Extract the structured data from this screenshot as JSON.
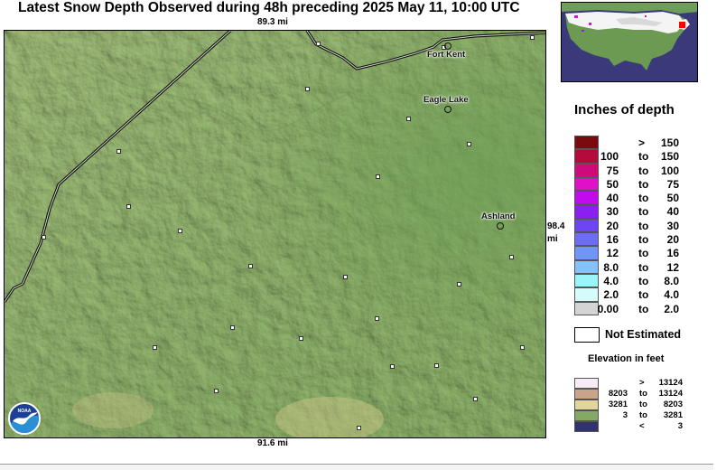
{
  "title": "Latest Snow Depth Observed during 48h preceding 2025 May 11, 10:00 UTC",
  "scale": {
    "top": "89.3 mi",
    "bottom": "91.6 mi",
    "right_value": "98.4",
    "right_unit": "mi"
  },
  "map": {
    "cities": [
      {
        "name": "Fort Kent"
      },
      {
        "name": "Eagle Lake"
      },
      {
        "name": "Ashland"
      }
    ],
    "station_count": 25,
    "logo_text": "NOAA",
    "colors": {
      "terrain_low": "#8db36a",
      "terrain_mid": "#a3c07c",
      "border": "#222222"
    }
  },
  "legend": {
    "title": "Inches of depth",
    "rows": [
      {
        "lo": "",
        "to": ">",
        "hi": "150",
        "color": "#7a0a0f"
      },
      {
        "lo": "100",
        "to": "to",
        "hi": "150",
        "color": "#b40a3c"
      },
      {
        "lo": "75",
        "to": "to",
        "hi": "100",
        "color": "#cf0a79"
      },
      {
        "lo": "50",
        "to": "to",
        "hi": "75",
        "color": "#df10c5"
      },
      {
        "lo": "40",
        "to": "to",
        "hi": "50",
        "color": "#c30aef"
      },
      {
        "lo": "30",
        "to": "to",
        "hi": "40",
        "color": "#8a1ff1"
      },
      {
        "lo": "20",
        "to": "to",
        "hi": "30",
        "color": "#6d45f3"
      },
      {
        "lo": "16",
        "to": "to",
        "hi": "20",
        "color": "#6c6df4"
      },
      {
        "lo": "12",
        "to": "to",
        "hi": "16",
        "color": "#6f96f6"
      },
      {
        "lo": "8.0",
        "to": "to",
        "hi": "12",
        "color": "#86c2fa"
      },
      {
        "lo": "4.0",
        "to": "to",
        "hi": "8.0",
        "color": "#9af5fb"
      },
      {
        "lo": "2.0",
        "to": "to",
        "hi": "4.0",
        "color": "#d6fbfb"
      },
      {
        "lo": "0.00",
        "to": "to",
        "hi": "2.0",
        "color": "#d4d4d4"
      }
    ],
    "not_estimated": "Not Estimated"
  },
  "elevation": {
    "title": "Elevation in feet",
    "rows": [
      {
        "lo": "",
        "to": ">",
        "hi": "13124",
        "color": "#f6ecf6"
      },
      {
        "lo": "8203",
        "to": "to",
        "hi": "13124",
        "color": "#c9a38a"
      },
      {
        "lo": "3281",
        "to": "to",
        "hi": "8203",
        "color": "#e2d49a"
      },
      {
        "lo": "3",
        "to": "to",
        "hi": "3281",
        "color": "#86a865"
      },
      {
        "lo": "",
        "to": "<",
        "hi": "3",
        "color": "#32326e"
      }
    ]
  }
}
